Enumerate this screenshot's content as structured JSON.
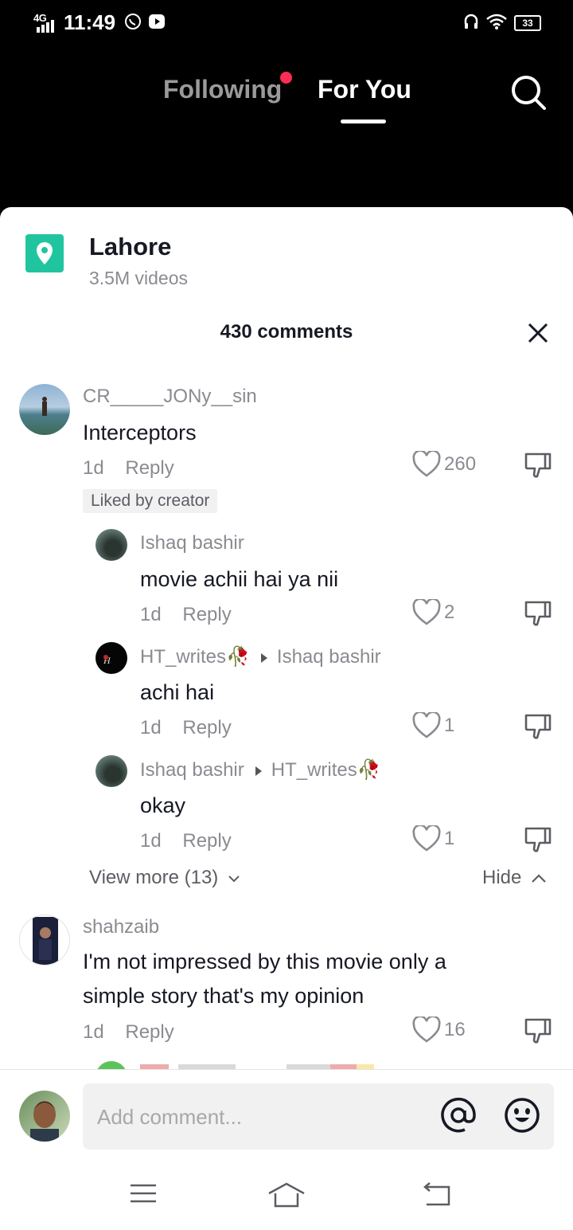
{
  "status_bar": {
    "network": "4G",
    "time": "11:49",
    "battery": "33"
  },
  "top_nav": {
    "following": "Following",
    "for_you": "For You"
  },
  "location": {
    "name": "Lahore",
    "videos": "3.5M videos"
  },
  "comments_header": {
    "count": "430 comments"
  },
  "comments": [
    {
      "user": "CR_____JONy__sin",
      "text": "Interceptors",
      "age": "1d",
      "reply": "Reply",
      "likes": "260",
      "badge": "Liked by creator",
      "replies": [
        {
          "user": "Ishaq bashir",
          "reply_to": "",
          "text": "movie achii hai ya nii",
          "age": "1d",
          "reply": "Reply",
          "likes": "2"
        },
        {
          "user": "HT_writes🥀",
          "reply_to": "Ishaq bashir",
          "text": "achi hai",
          "age": "1d",
          "reply": "Reply",
          "likes": "1"
        },
        {
          "user": "Ishaq bashir",
          "reply_to": "HT_writes🥀",
          "text": "okay",
          "age": "1d",
          "reply": "Reply",
          "likes": "1"
        }
      ],
      "view_more": "View more (13)",
      "hide": "Hide"
    },
    {
      "user": "shahzaib",
      "text": "I'm not impressed by this movie only a simple story that's my opinion",
      "age": "1d",
      "reply": "Reply",
      "likes": "16"
    }
  ],
  "input": {
    "placeholder": "Add comment..."
  },
  "colors": {
    "accent": "#fe2c55",
    "location_icon": "#20c5a0",
    "muted_text": "#8a8b91"
  }
}
